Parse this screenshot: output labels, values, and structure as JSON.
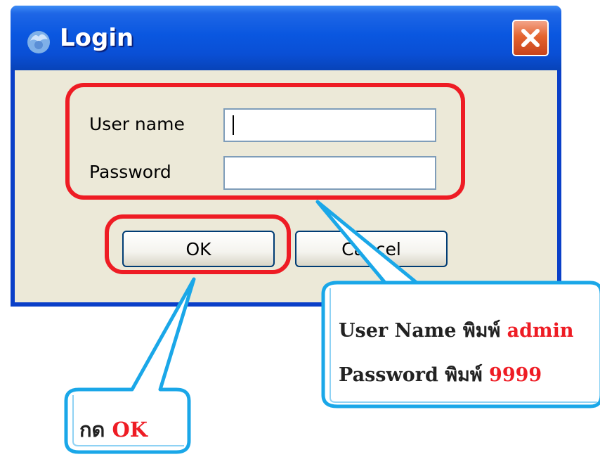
{
  "dialog": {
    "title": "Login",
    "username_label": "User name",
    "password_label": "Password",
    "username_value": "",
    "password_value": "",
    "ok_label": "OK",
    "cancel_label": "Cancel"
  },
  "callouts": {
    "credentials": {
      "user_prefix": "User Name พิมพ์",
      "user_value": "admin",
      "pass_prefix": "Password พิมพ์",
      "pass_value": "9999"
    },
    "ok_hint": {
      "prefix": "กด",
      "value": "OK"
    }
  },
  "colors": {
    "highlight": "#ee1c24",
    "callout_border": "#1aa7e8",
    "titlebar": "#0a57e0",
    "dialog_face": "#ece9d8"
  }
}
